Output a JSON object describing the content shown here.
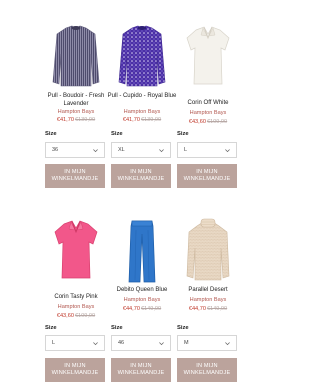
{
  "labels": {
    "size": "Size",
    "cart_line1": "IN MIJN",
    "cart_line2": "WINKELMANDJE"
  },
  "products": [
    {
      "name": "Pull - Boudoir - Fresh Lavender",
      "brand": "Hampton Bays",
      "price": "€41,70",
      "old_price": "€139,00",
      "size": "36",
      "image_icon": "striped-sweater-icon",
      "color": "#6d6a8a"
    },
    {
      "name": "Pull - Cupido - Royal Blue",
      "brand": "Hampton Bays",
      "price": "€41,70",
      "old_price": "€139,00",
      "size": "XL",
      "image_icon": "patterned-sweater-icon",
      "color": "#5a3fb0"
    },
    {
      "name": "Corin Off White",
      "brand": "Hampton Bays",
      "price": "€43,60",
      "old_price": "€109,00",
      "size": "L",
      "image_icon": "polo-top-icon",
      "color": "#f2f0ea"
    },
    {
      "name": "Corin Tasty Pink",
      "brand": "Hampton Bays",
      "price": "€43,60",
      "old_price": "€109,00",
      "size": "L",
      "image_icon": "polo-top-icon",
      "color": "#f25a8a"
    },
    {
      "name": "Debito Queen Blue",
      "brand": "Hampton Bays",
      "price": "€44,70",
      "old_price": "€149,00",
      "size": "46",
      "image_icon": "trousers-icon",
      "color": "#2f76c9"
    },
    {
      "name": "Parallel Desert",
      "brand": "Hampton Bays",
      "price": "€44,70",
      "old_price": "€149,00",
      "size": "M",
      "image_icon": "knit-sweater-icon",
      "color": "#e6d5c0"
    }
  ]
}
